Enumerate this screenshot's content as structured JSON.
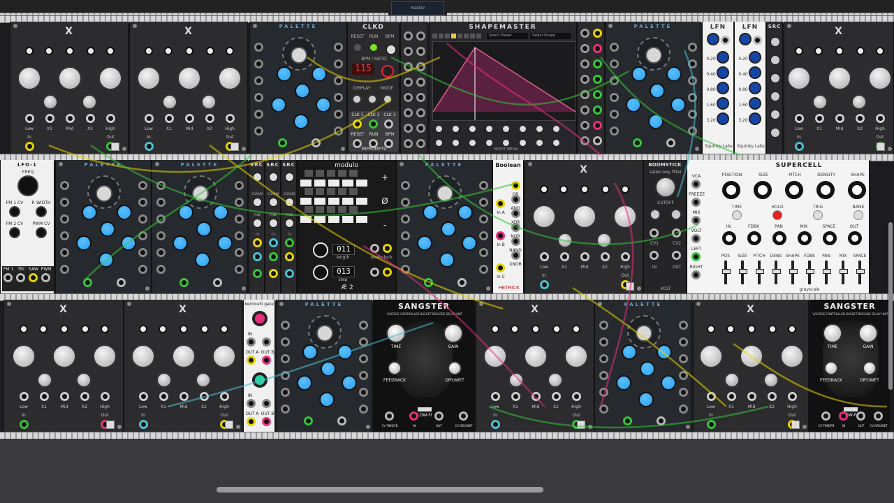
{
  "top_tab": {
    "label": "master"
  },
  "colors": {
    "rail": "#d8d8d8",
    "panel_dark": "#2a2a2c",
    "palette_knob": "#29a0f0",
    "green_jack": "#37c43b",
    "yellow_jack": "#e8d400",
    "pink_jack": "#e8307a",
    "red_led": "#e52020"
  },
  "eq_module": {
    "title": "X",
    "labels": {
      "low": "Low",
      "x1": "X1",
      "mid": "Mid",
      "x2": "X2",
      "high": "High",
      "in": "In",
      "out": "Out"
    }
  },
  "palette": {
    "title": "PALETTE"
  },
  "clkd": {
    "title": "CLKD",
    "reset": "RESET",
    "run": "RUN",
    "bpm": "BPM",
    "bpm_ratio": "BPM / RATIO",
    "display": "115",
    "display_label": "DISPLAY",
    "mode_label": "MODE",
    "clk1": "CLK 1",
    "clk2": "CLK 2",
    "clk3": "CLK 3",
    "brand": "IMPROMPTU"
  },
  "shapemaster": {
    "title": "SHAPEMASTER",
    "select_preset": "Select Preset",
    "select_shape": "Select Shape",
    "brand": "MISFIT MEDIA"
  },
  "lfn": {
    "title": "LFN",
    "values": [
      "0.20",
      "0.40",
      "0.80",
      "1.60",
      "3.20"
    ],
    "brand": "Squinky Labs"
  },
  "lfo": {
    "title": "LFO-1",
    "freq": "FREQ",
    "fm1": "FM 1 CV",
    "pwidth": "P. WIDTH",
    "fm2": "FM 2 CV",
    "pwm": "PWM CV",
    "outs": [
      "FM 1",
      "TRI",
      "SAW",
      "PWM"
    ],
    "brand": "VCV"
  },
  "src": {
    "title": "SRC",
    "coarse": "COARSE",
    "fine": "FINE",
    "cv": "CV"
  },
  "modulo": {
    "title": "modulo",
    "counter_top": "011",
    "counter_bottom": "013",
    "length_label": "length",
    "step_label": "step",
    "reset": "reset",
    "clock": "clock",
    "plus": "+",
    "minus": "-",
    "null": "Ø",
    "brand": "Æ 2"
  },
  "boolean": {
    "title": "Boolean",
    "ops": [
      "OR",
      "AND",
      "XOR",
      "NOR",
      "NAND",
      "XNOR"
    ],
    "inputs": [
      "In A",
      "In B",
      "In C"
    ],
    "brand": "HETRICK"
  },
  "boomstick": {
    "title": "BOOMSTICK",
    "subtitle": "sallen-key filter",
    "cutoff": "CUTOFF",
    "volt": "VOLT",
    "cv1": "CV1",
    "cv2": "CV2",
    "in": "IN",
    "out": "OUT"
  },
  "supercell": {
    "title": "SUPERCELL",
    "knobs": [
      "POSITION",
      "SIZE",
      "PITCH",
      "DENSITY",
      "SHAPE"
    ],
    "row2": [
      "TIME",
      "HOLD",
      "TRIG",
      "BANK"
    ],
    "row3": [
      "IN",
      "FDBK",
      "PAN",
      "MIX",
      "SPACE",
      "OUT"
    ],
    "row4": [
      "POS",
      "SIZE",
      "PITCH",
      "DENS",
      "SHAPE",
      "FDBK",
      "PAN",
      "MIX",
      "SPACE"
    ],
    "left_labels": [
      "VCA",
      "FREEZE",
      "MIX",
      "VOLT",
      "LEFT",
      "RIGHT"
    ],
    "brand": "grayscale"
  },
  "bernoulli": {
    "title": "bernoulli gate",
    "in": "IN",
    "out_a": "OUT A",
    "out_b": "OUT B"
  },
  "sangster": {
    "title": "SANGSTER",
    "subtitle": "VOLTAGE CONTROLLED BUCKET BRIGADE DELAY UNIT",
    "time": "TIME",
    "gain": "GAIN",
    "feedback": "FEEDBACK",
    "drywet": "DRY/WET",
    "lofi": "LOW-FI",
    "jacks": [
      "CV TIME/FB",
      "IN",
      "OUT",
      "CV DRY/WET"
    ],
    "brand": "LINDENBERG RESEARCH"
  }
}
